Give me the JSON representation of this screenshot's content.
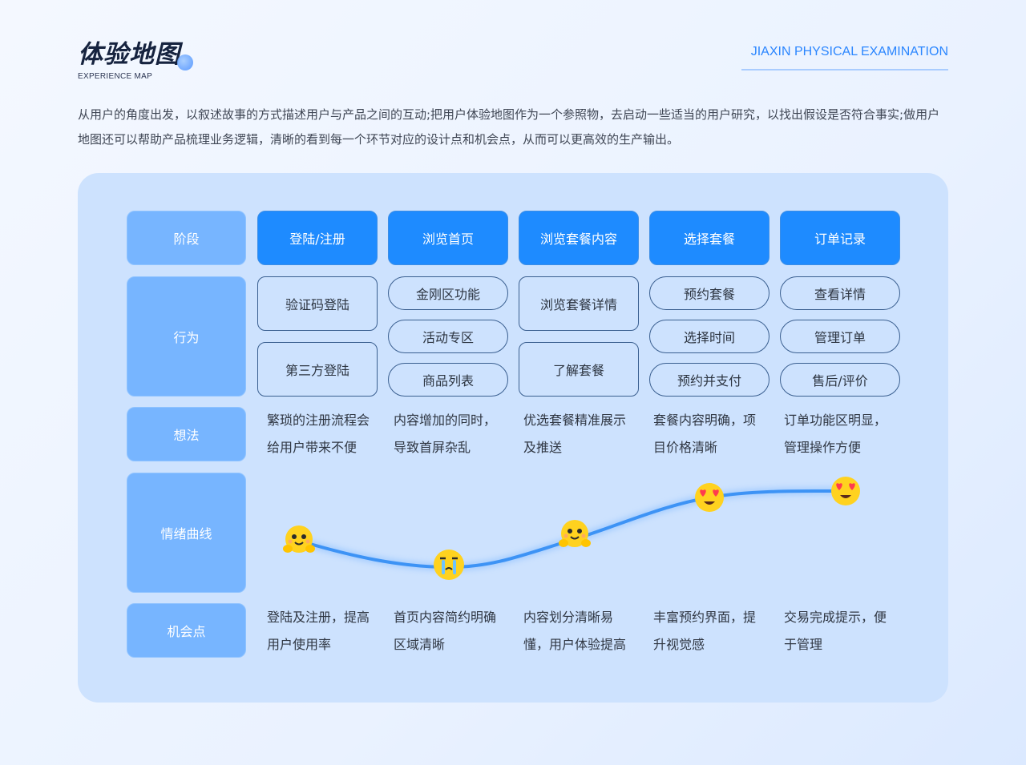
{
  "header": {
    "title": "体验地图",
    "subtitle": "EXPERIENCE MAP",
    "brand": "JIAXIN PHYSICAL EXAMINATION"
  },
  "intro": "从用户的角度出发，以叙述故事的方式描述用户与产品之间的互动;把用户体验地图作为一个参照物，去启动一些适当的用户研究，以找出假设是否符合事实;做用户地图还可以帮助产品梳理业务逻辑，清晰的看到每一个环节对应的设计点和机会点，从而可以更高效的生产输出。",
  "rows": {
    "stage": "阶段",
    "behavior": "行为",
    "thought": "想法",
    "emotion": "情绪曲线",
    "opportunity": "机会点"
  },
  "stages": [
    {
      "name": "登陆/注册",
      "actions": [
        "验证码登陆",
        "第三方登陆"
      ],
      "thought": [
        "繁琐的注册流程会",
        "给用户带来不便"
      ],
      "opportunity": [
        "登陆及注册，提高",
        "用户使用率"
      ],
      "emotion": "happy-face-icon"
    },
    {
      "name": "浏览首页",
      "actions": [
        "金刚区功能",
        "活动专区",
        "商品列表"
      ],
      "thought": [
        "内容增加的同时，",
        "导致首屏杂乱"
      ],
      "opportunity": [
        "首页内容简约明确",
        "区域清晰"
      ],
      "emotion": "crying-face-icon"
    },
    {
      "name": "浏览套餐内容",
      "actions": [
        "浏览套餐详情",
        "了解套餐"
      ],
      "thought": [
        "优选套餐精准展示",
        "及推送"
      ],
      "opportunity": [
        "内容划分清晰易",
        "懂，用户体验提高"
      ],
      "emotion": "happy-face-icon"
    },
    {
      "name": "选择套餐",
      "actions": [
        "预约套餐",
        "选择时间",
        "预约并支付"
      ],
      "thought": [
        "套餐内容明确，项",
        "目价格清晰"
      ],
      "opportunity": [
        "丰富预约界面，提",
        "升视觉感"
      ],
      "emotion": "heart-eyes-face-icon"
    },
    {
      "name": "订单记录",
      "actions": [
        "查看详情",
        "管理订单",
        "售后/评价"
      ],
      "thought": [
        "订单功能区明显，",
        "管理操作方便"
      ],
      "opportunity": [
        "交易完成提示，便",
        "于管理"
      ],
      "emotion": "heart-eyes-face-icon"
    }
  ],
  "colors": {
    "accent": "#1e8bff",
    "row_header": "#77b5ff",
    "panel": "#cde2fe",
    "curve": "#3d93f5",
    "emoji": "#ffd21f"
  }
}
